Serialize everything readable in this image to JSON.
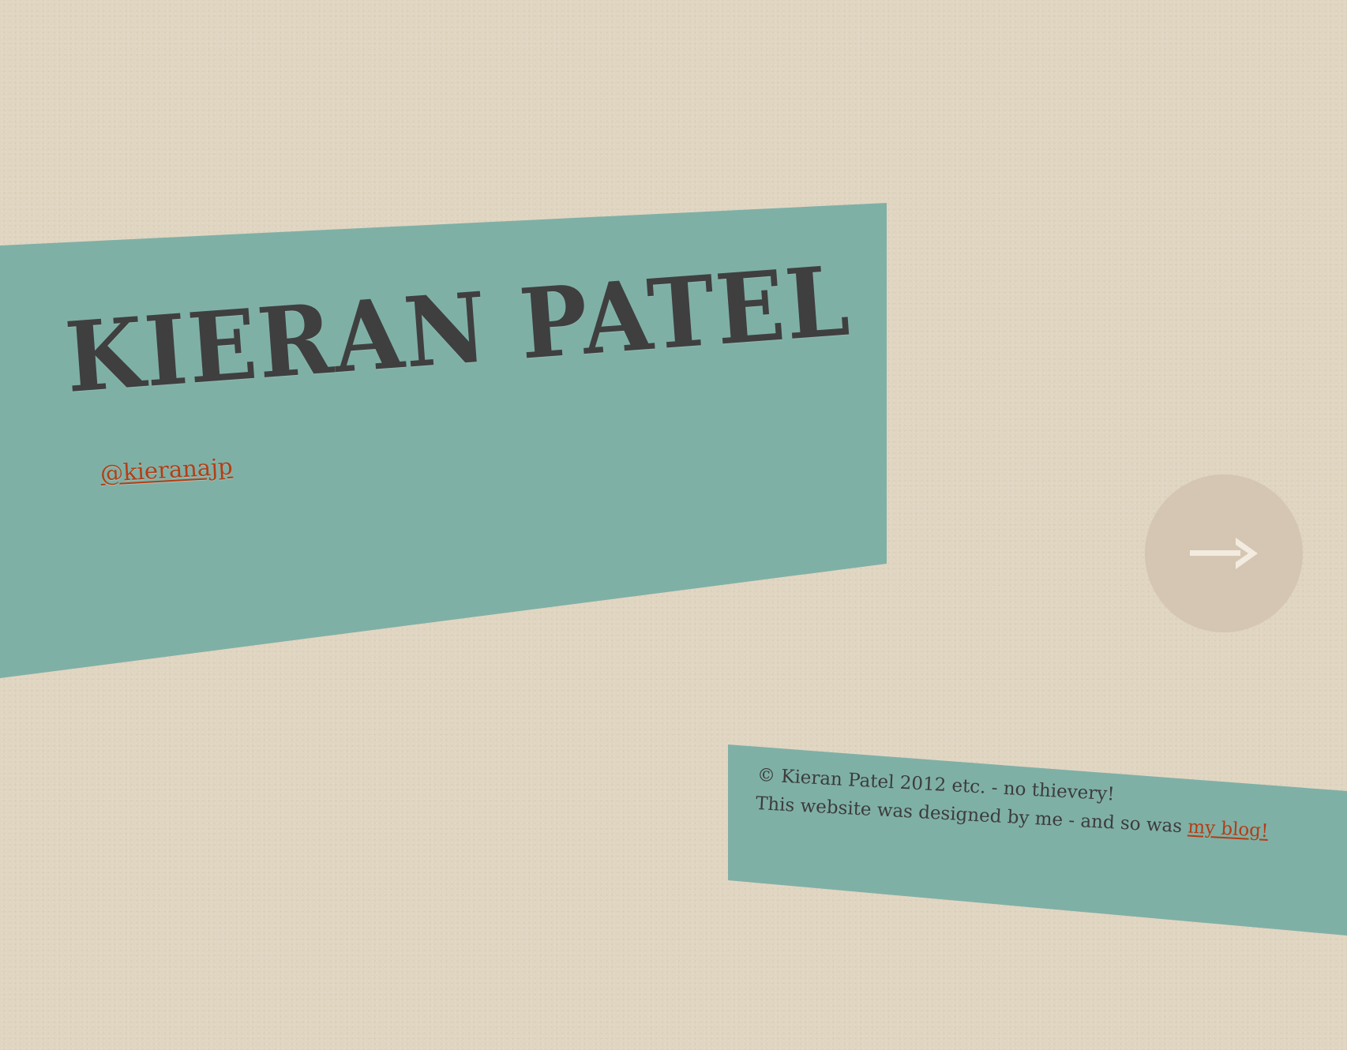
{
  "colors": {
    "background": "#e0d5c1",
    "panel": "#7fb0a6",
    "title_text": "#3f3f3f",
    "link": "#b43d14",
    "next_button": "#d4c6b2",
    "arrow": "#f3ebdf"
  },
  "hero": {
    "title": "KIERAN PATEL",
    "twitter_handle": "@kieranajp"
  },
  "navigation": {
    "next_icon": "right-arrow-icon"
  },
  "footer": {
    "copyright": "© Kieran Patel 2012 etc. - no thievery!",
    "designed_text": "This website was designed by me - and so was ",
    "blog_link": "my blog!"
  }
}
